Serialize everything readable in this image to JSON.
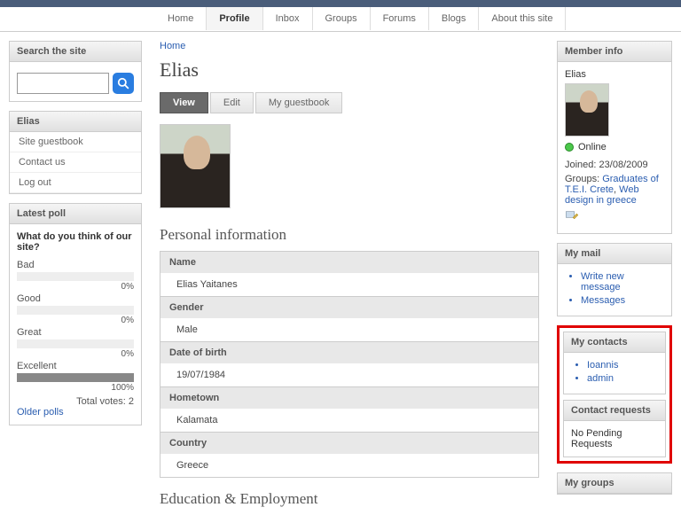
{
  "nav": {
    "items": [
      "Home",
      "Profile",
      "Inbox",
      "Groups",
      "Forums",
      "Blogs",
      "About this site"
    ],
    "active_index": 1
  },
  "left": {
    "search_header": "Search the site",
    "search_placeholder": "",
    "user_header": "Elias",
    "user_links": [
      "Site guestbook",
      "Contact us",
      "Log out"
    ],
    "poll_header": "Latest poll",
    "poll_question": "What do you think of our site?",
    "poll_options": [
      {
        "label": "Bad",
        "pct": 0
      },
      {
        "label": "Good",
        "pct": 0
      },
      {
        "label": "Great",
        "pct": 0
      },
      {
        "label": "Excellent",
        "pct": 100
      }
    ],
    "poll_total_label": "Total votes:",
    "poll_total": "2",
    "older_polls": "Older polls"
  },
  "main": {
    "breadcrumb": "Home",
    "title": "Elias",
    "tabs": [
      "View",
      "Edit",
      "My guestbook"
    ],
    "active_tab": 0,
    "section_personal": "Personal information",
    "rows": [
      {
        "h": "Name",
        "v": "Elias Yaitanes"
      },
      {
        "h": "Gender",
        "v": "Male"
      },
      {
        "h": "Date of birth",
        "v": "19/07/1984"
      },
      {
        "h": "Hometown",
        "v": "Kalamata"
      },
      {
        "h": "Country",
        "v": "Greece"
      }
    ],
    "section_edu": "Education & Employment"
  },
  "right": {
    "member_info_header": "Member info",
    "member_name": "Elias",
    "status": "Online",
    "joined_label": "Joined:",
    "joined": "23/08/2009",
    "groups_label": "Groups:",
    "groups": [
      "Graduates of T.E.I. Crete",
      "Web design in greece"
    ],
    "mail_header": "My mail",
    "mail_items": [
      "Write new message",
      "Messages"
    ],
    "contacts_header": "My contacts",
    "contacts": [
      "Ioannis",
      "admin"
    ],
    "requests_header": "Contact requests",
    "requests_text": "No Pending Requests",
    "my_groups_header": "My groups"
  }
}
